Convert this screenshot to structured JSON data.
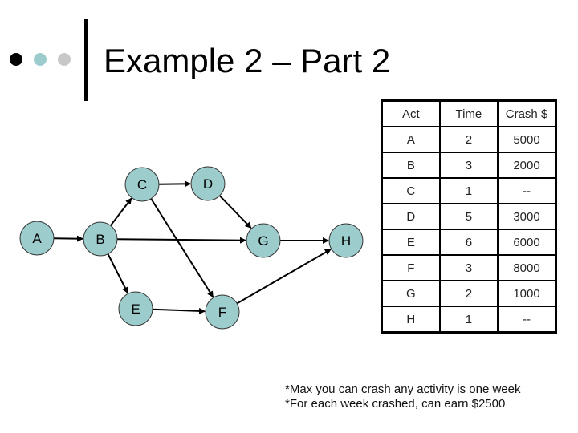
{
  "header": {
    "title": "Example 2 – Part 2",
    "bullet_colors": [
      "#000000",
      "#9ccccc",
      "#c8c8c8"
    ]
  },
  "diagram": {
    "node_fill": "#9ccccc",
    "node_stroke": "#333333",
    "nodes": [
      {
        "id": "A",
        "label": "A"
      },
      {
        "id": "B",
        "label": "B"
      },
      {
        "id": "C",
        "label": "C"
      },
      {
        "id": "D",
        "label": "D"
      },
      {
        "id": "E",
        "label": "E"
      },
      {
        "id": "F",
        "label": "F"
      },
      {
        "id": "G",
        "label": "G"
      },
      {
        "id": "H",
        "label": "H"
      }
    ],
    "edges": [
      {
        "from": "A",
        "to": "B"
      },
      {
        "from": "B",
        "to": "C"
      },
      {
        "from": "B",
        "to": "G"
      },
      {
        "from": "B",
        "to": "E"
      },
      {
        "from": "C",
        "to": "D"
      },
      {
        "from": "C",
        "to": "F"
      },
      {
        "from": "D",
        "to": "G"
      },
      {
        "from": "E",
        "to": "F"
      },
      {
        "from": "G",
        "to": "H"
      },
      {
        "from": "F",
        "to": "H"
      }
    ]
  },
  "table": {
    "headers": [
      "Act",
      "Time",
      "Crash $"
    ],
    "rows": [
      [
        "A",
        "2",
        "5000"
      ],
      [
        "B",
        "3",
        "2000"
      ],
      [
        "C",
        "1",
        "--"
      ],
      [
        "D",
        "5",
        "3000"
      ],
      [
        "E",
        "6",
        "6000"
      ],
      [
        "F",
        "3",
        "8000"
      ],
      [
        "G",
        "2",
        "1000"
      ],
      [
        "H",
        "1",
        "--"
      ]
    ]
  },
  "notes": [
    "*Max you can crash any activity is one week",
    "*For each week crashed, can earn $2500"
  ]
}
